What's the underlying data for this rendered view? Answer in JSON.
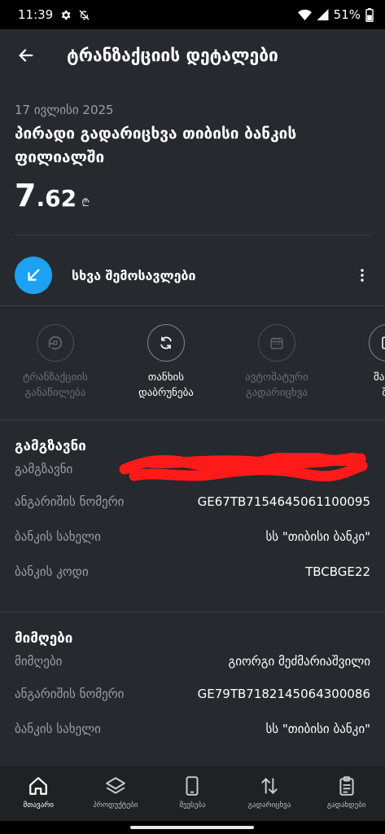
{
  "status_bar": {
    "time": "11:39",
    "battery": "51%"
  },
  "header": {
    "title": "ტრანზაქციის დეტალები"
  },
  "transaction": {
    "date": "17 ივლისი 2025",
    "title": "პირადი გადარიცხვა თიბისი ბანკის ფილიალში",
    "amount_int": "7",
    "amount_dec": ".62",
    "currency": "₾"
  },
  "category": {
    "label": "სხვა შემოსავლები"
  },
  "actions": [
    {
      "label": "ტრანზაქციის\nგანაწილება",
      "enabled": false,
      "icon": "split-icon"
    },
    {
      "label": "თანხის\nდაბრუნება",
      "enabled": true,
      "icon": "refresh-icon"
    },
    {
      "label": "ავტომატური\nგადარიცხვა",
      "enabled": false,
      "icon": "calendar-icon"
    },
    {
      "label": "შაბლ\nშე",
      "enabled": true,
      "icon": "template-icon"
    }
  ],
  "sender": {
    "heading": "გამგზავნი",
    "rows": [
      {
        "label": "გამგზავნი",
        "value": ""
      },
      {
        "label": "ანგარიშის ნომერი",
        "value": "GE67TB7154645061100095"
      },
      {
        "label": "ბანკის სახელი",
        "value": "სს \"თიბისი ბანკი\""
      },
      {
        "label": "ბანკის კოდი",
        "value": "TBCBGE22"
      }
    ]
  },
  "receiver": {
    "heading": "მიმღები",
    "rows": [
      {
        "label": "მიმღები",
        "value": "გიორგი მეძმარიაშვილი"
      },
      {
        "label": "ანგარიშის ნომერი",
        "value": "GE79TB7182145064300086"
      },
      {
        "label": "ბანკის სახელი",
        "value": "სს \"თიბისი ბანკი\""
      }
    ]
  },
  "bottom_nav": [
    {
      "label": "მთავარი",
      "icon": "home-icon",
      "active": true
    },
    {
      "label": "პროდუქტები",
      "icon": "layers-icon",
      "active": false
    },
    {
      "label": "შევსება",
      "icon": "phone-icon",
      "active": false
    },
    {
      "label": "გადარიცხვა",
      "icon": "transfer-icon",
      "active": false
    },
    {
      "label": "გადახდები",
      "icon": "clipboard-icon",
      "active": false
    }
  ],
  "colors": {
    "accent": "#1da1f2",
    "background": "#26292d",
    "redaction": "#ff1a1a"
  }
}
